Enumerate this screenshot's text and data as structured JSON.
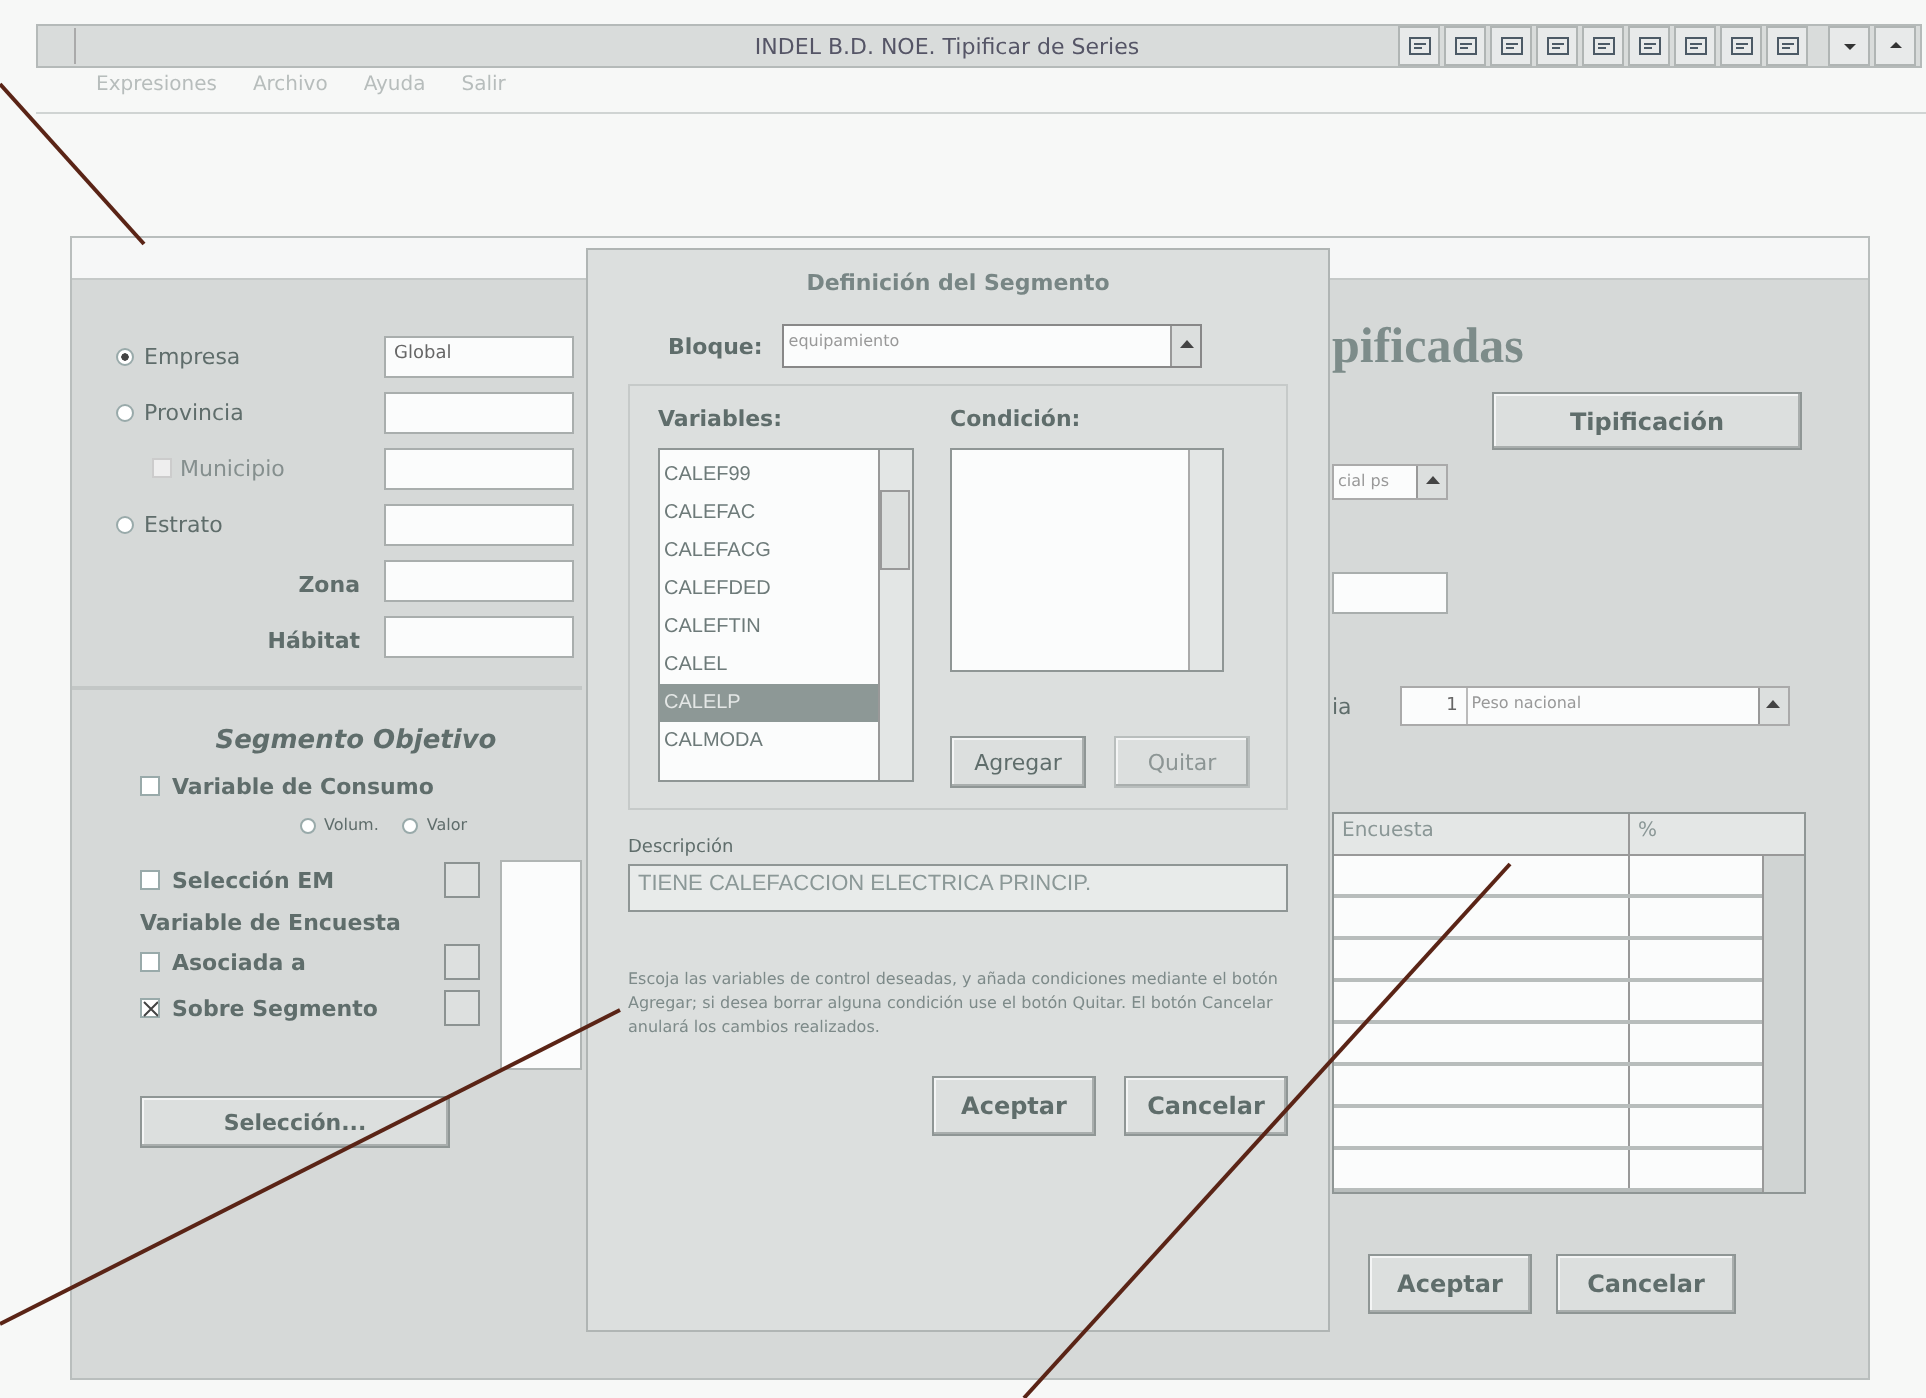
{
  "app": {
    "title": "INDEL B.D. NOE. Tipificar de Series",
    "menu": [
      "Expresiones",
      "Archivo",
      "Ayuda",
      "Salir"
    ]
  },
  "main_dialog": {
    "heading": "pificadas",
    "scope": [
      {
        "kind": "radio",
        "label": "Empresa",
        "selected": true,
        "value": "Global"
      },
      {
        "kind": "radio",
        "label": "Provincia",
        "selected": false
      },
      {
        "kind": "checkbox",
        "label": "Municipio",
        "checked": false,
        "disabled": true
      },
      {
        "kind": "radio",
        "label": "Estrato",
        "selected": false
      },
      {
        "kind": "field",
        "label": "Zona"
      },
      {
        "kind": "field",
        "label": "Hábitat"
      }
    ],
    "segment": {
      "title": "Segmento Objetivo",
      "consumo": {
        "label": "Variable de Consumo",
        "checked": false,
        "options": [
          {
            "label": "Volum.",
            "selected": false
          },
          {
            "label": "Valor",
            "selected": false
          }
        ]
      },
      "em": {
        "label": "Selección EM",
        "checked": false
      },
      "encuesta_label": "Variable de Encuesta",
      "encuesta": [
        {
          "label": "Asociada a",
          "checked": false
        },
        {
          "label": "Sobre Segmento",
          "checked": true
        }
      ],
      "button": "Selección..."
    },
    "tip_button": "Tipificación",
    "combo_value": "cial ps",
    "weight_label": "ia",
    "weight_number": "1",
    "weight_value": "Peso nacional",
    "table": {
      "columns": [
        "Encuesta",
        "%"
      ]
    },
    "buttons": [
      "Aceptar",
      "Cancelar"
    ]
  },
  "segment_dialog": {
    "title": "Definición del Segmento",
    "bloque_label": "Bloque:",
    "bloque_value": "equipamiento",
    "variables_label": "Variables:",
    "variables": [
      {
        "text": "CALEF99",
        "selected": false
      },
      {
        "text": "CALEFAC",
        "selected": false
      },
      {
        "text": "CALEFACG",
        "selected": false
      },
      {
        "text": "CALEFDED",
        "selected": false
      },
      {
        "text": "CALEFTIN",
        "selected": false
      },
      {
        "text": "CALEL",
        "selected": false
      },
      {
        "text": "CALELP",
        "selected": true
      },
      {
        "text": "CALMODA",
        "selected": false
      }
    ],
    "condition_label": "Condición:",
    "actions": [
      {
        "label": "Agregar",
        "disabled": false
      },
      {
        "label": "Quitar",
        "disabled": true
      }
    ],
    "description_label": "Descripción",
    "description": "TIENE CALEFACCION ELECTRICA PRINCIP.",
    "help": "Escoja las variables de control deseadas, y añada condiciones mediante el botón Agregar; si desea borrar alguna condición use el botón Quitar. El botón Cancelar anulará los cambios realizados.",
    "buttons": [
      "Aceptar",
      "Cancelar"
    ]
  }
}
